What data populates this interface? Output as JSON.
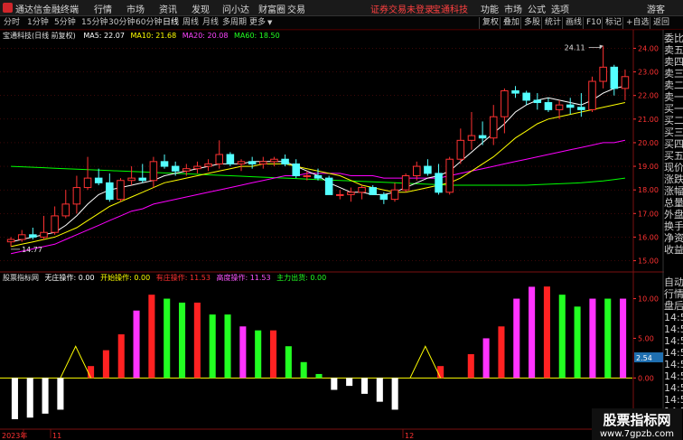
{
  "titlebar": {
    "app_title": "通达信金融终端",
    "menu": [
      "行情",
      "市场",
      "资讯",
      "发现",
      "问小达",
      "财富圈",
      "交易"
    ],
    "notice": "证券交易未登录",
    "stock_name": "宝通科技",
    "right": [
      "功能",
      "市场",
      "公式",
      "选项"
    ],
    "guest": "游客"
  },
  "toolbar": {
    "periods": [
      "分时",
      "1分钟",
      "5分钟",
      "15分钟",
      "30分钟",
      "60分钟",
      "日线",
      "周线",
      "月线",
      "多周期",
      "更多"
    ],
    "active_period": "日线",
    "right_buttons": [
      "复权",
      "叠加",
      "多股",
      "统计",
      "画线",
      "F10",
      "标记",
      "+自选",
      "返回"
    ]
  },
  "colors": {
    "up": "#ff3232",
    "down": "#54ffff",
    "ma5": "#ffffff",
    "ma10": "#ffff00",
    "ma20": "#ff00ff",
    "ma60": "#00ff00",
    "magenta_bar": "#ff33ff",
    "green_bar": "#22ff22",
    "red_bar": "#ff2222",
    "white_bar": "#ffffff",
    "yellow_line": "#ffff00",
    "grid": "#7a1010"
  },
  "main_info": {
    "name": "宝通科技(日线 前复权)",
    "ma5_label": "MA5: 22.07",
    "ma10_label": "MA10: 21.68",
    "ma20_label": "MA20: 20.08",
    "ma60_label": "MA60: 18.50"
  },
  "indicator_info": {
    "name": "股票指标网",
    "items": [
      {
        "label": "无庄操作: 0.00",
        "color": "#ffffff"
      },
      {
        "label": "开始操作: 0.00",
        "color": "#ffff00"
      },
      {
        "label": "有庄操作: 11.53",
        "color": "#ff3030"
      },
      {
        "label": "高度操作: 11.53",
        "color": "#ff55ff"
      },
      {
        "label": "主力出货: 0.00",
        "color": "#22ff22"
      }
    ]
  },
  "annotations": {
    "high": "24.11",
    "low": "14.77",
    "current_indicator": "2.54"
  },
  "axis": {
    "price_ticks": [
      "24.00",
      "23.00",
      "22.00",
      "21.00",
      "20.00",
      "19.00",
      "18.00",
      "17.00",
      "16.00",
      "15.00"
    ],
    "indicator_ticks": [
      "10.00",
      "5.00",
      "0.00"
    ],
    "x_labels": [
      "2023年",
      "11",
      "12"
    ]
  },
  "right_panel": {
    "top_items": [
      "委比",
      "卖五",
      "卖四",
      "卖三",
      "卖二",
      "卖一",
      "买一",
      "买二",
      "买三",
      "买四",
      "买五",
      "现价",
      "涨跌",
      "涨幅",
      "总量",
      "外盘",
      "换手",
      "净资",
      "收益"
    ],
    "bottom_items": [
      "自动",
      "行情",
      "盘后",
      "14:5",
      "14:5",
      "14:5",
      "14:5",
      "14:5",
      "14:5",
      "14:5",
      "14:5",
      "14:5"
    ]
  },
  "watermark": {
    "text": "股票指标网",
    "url": "www.7gpzb.com"
  },
  "chart_data": [
    {
      "type": "candlestick",
      "title": "宝通科技(日线 前复权)",
      "ylim": [
        14.6,
        24.4
      ],
      "y_ticks": [
        15,
        16,
        17,
        18,
        19,
        20,
        21,
        22,
        23,
        24
      ],
      "candles_ohlc": [
        [
          15.8,
          16.0,
          15.6,
          15.9
        ],
        [
          15.9,
          16.3,
          15.8,
          16.1
        ],
        [
          16.1,
          16.4,
          15.9,
          16.0
        ],
        [
          16.0,
          16.9,
          15.9,
          16.2
        ],
        [
          16.2,
          17.3,
          16.1,
          16.9
        ],
        [
          16.9,
          18.0,
          16.8,
          17.4
        ],
        [
          17.4,
          18.6,
          17.0,
          18.1
        ],
        [
          18.1,
          19.4,
          18.0,
          18.5
        ],
        [
          18.5,
          18.9,
          18.2,
          18.3
        ],
        [
          18.3,
          18.7,
          17.5,
          17.6
        ],
        [
          17.6,
          18.5,
          17.5,
          18.4
        ],
        [
          18.4,
          19.0,
          18.2,
          18.5
        ],
        [
          18.5,
          19.1,
          18.3,
          18.4
        ],
        [
          18.4,
          19.4,
          18.1,
          19.2
        ],
        [
          19.2,
          19.5,
          18.9,
          19.0
        ],
        [
          19.0,
          19.2,
          18.6,
          18.8
        ],
        [
          18.8,
          19.1,
          18.6,
          18.9
        ],
        [
          18.9,
          19.2,
          18.7,
          19.0
        ],
        [
          19.0,
          19.3,
          18.8,
          19.1
        ],
        [
          19.1,
          20.1,
          18.9,
          19.5
        ],
        [
          19.5,
          19.6,
          19.0,
          19.1
        ],
        [
          19.1,
          19.3,
          18.8,
          19.2
        ],
        [
          19.2,
          19.4,
          18.9,
          19.1
        ],
        [
          19.1,
          19.4,
          18.9,
          19.2
        ],
        [
          19.2,
          19.4,
          19.0,
          19.3
        ],
        [
          19.3,
          19.5,
          19.0,
          19.1
        ],
        [
          19.1,
          19.3,
          18.5,
          18.6
        ],
        [
          18.6,
          18.8,
          18.4,
          18.6
        ],
        [
          18.6,
          18.9,
          18.4,
          18.5
        ],
        [
          18.5,
          18.6,
          17.8,
          17.8
        ],
        [
          17.8,
          18.0,
          17.6,
          17.8
        ],
        [
          17.8,
          18.1,
          17.5,
          17.9
        ],
        [
          17.9,
          18.2,
          17.6,
          18.1
        ],
        [
          18.1,
          18.2,
          17.8,
          17.8
        ],
        [
          17.8,
          17.9,
          17.4,
          17.6
        ],
        [
          17.6,
          18.3,
          17.5,
          18.0
        ],
        [
          18.0,
          18.7,
          17.9,
          18.6
        ],
        [
          18.6,
          19.2,
          18.4,
          19.0
        ],
        [
          19.0,
          19.3,
          18.6,
          18.7
        ],
        [
          18.7,
          19.1,
          17.8,
          17.9
        ],
        [
          17.9,
          19.4,
          17.8,
          19.3
        ],
        [
          19.3,
          20.6,
          19.1,
          20.1
        ],
        [
          20.1,
          21.3,
          19.7,
          20.3
        ],
        [
          20.3,
          20.9,
          19.9,
          20.2
        ],
        [
          20.2,
          21.6,
          19.9,
          21.1
        ],
        [
          21.1,
          22.3,
          20.4,
          22.2
        ],
        [
          22.2,
          22.4,
          21.9,
          22.1
        ],
        [
          22.1,
          22.2,
          21.6,
          21.8
        ],
        [
          21.8,
          22.1,
          21.4,
          21.7
        ],
        [
          21.7,
          21.9,
          21.3,
          21.4
        ],
        [
          21.4,
          21.8,
          21.0,
          21.6
        ],
        [
          21.6,
          21.9,
          21.2,
          21.5
        ],
        [
          21.5,
          22.1,
          21.1,
          21.4
        ],
        [
          21.4,
          22.8,
          21.3,
          22.6
        ],
        [
          22.6,
          24.11,
          22.3,
          23.2
        ],
        [
          23.2,
          23.3,
          22.0,
          22.3
        ],
        [
          22.3,
          23.1,
          21.8,
          22.8
        ]
      ],
      "ma5": [
        15.8,
        15.9,
        16.0,
        16.1,
        16.2,
        16.5,
        16.9,
        17.4,
        17.8,
        18.0,
        18.1,
        18.2,
        18.3,
        18.4,
        18.6,
        18.7,
        18.8,
        18.9,
        19.0,
        19.1,
        19.1,
        19.1,
        19.2,
        19.2,
        19.2,
        19.2,
        19.0,
        18.8,
        18.6,
        18.3,
        18.1,
        17.9,
        17.9,
        17.8,
        17.8,
        17.9,
        18.1,
        18.3,
        18.5,
        18.6,
        18.8,
        19.2,
        19.6,
        20.0,
        20.4,
        20.8,
        21.3,
        21.6,
        21.8,
        21.9,
        21.8,
        21.7,
        21.6,
        21.8,
        22.1,
        22.3,
        22.4
      ],
      "ma10": [
        15.6,
        15.7,
        15.8,
        15.9,
        16.0,
        16.2,
        16.4,
        16.7,
        17.0,
        17.3,
        17.5,
        17.7,
        17.9,
        18.1,
        18.3,
        18.4,
        18.5,
        18.6,
        18.7,
        18.8,
        18.9,
        19.0,
        19.0,
        19.1,
        19.1,
        19.1,
        19.0,
        18.9,
        18.8,
        18.7,
        18.6,
        18.4,
        18.2,
        18.1,
        18.0,
        17.9,
        17.9,
        18.0,
        18.1,
        18.2,
        18.3,
        18.5,
        18.8,
        19.1,
        19.4,
        19.8,
        20.2,
        20.5,
        20.8,
        21.0,
        21.1,
        21.2,
        21.3,
        21.4,
        21.5,
        21.6,
        21.7
      ],
      "ma20": [
        15.3,
        15.4,
        15.5,
        15.6,
        15.7,
        15.9,
        16.1,
        16.3,
        16.5,
        16.7,
        16.9,
        17.1,
        17.2,
        17.4,
        17.5,
        17.6,
        17.7,
        17.8,
        17.9,
        18.0,
        18.1,
        18.2,
        18.3,
        18.4,
        18.5,
        18.6,
        18.6,
        18.7,
        18.7,
        18.7,
        18.7,
        18.6,
        18.6,
        18.6,
        18.5,
        18.5,
        18.5,
        18.5,
        18.5,
        18.5,
        18.6,
        18.7,
        18.8,
        18.9,
        19.0,
        19.1,
        19.2,
        19.3,
        19.4,
        19.5,
        19.6,
        19.7,
        19.8,
        19.9,
        20.0,
        20.0,
        20.1
      ],
      "ma60": [
        19.0,
        18.98,
        18.96,
        18.94,
        18.92,
        18.9,
        18.88,
        18.86,
        18.84,
        18.82,
        18.8,
        18.78,
        18.76,
        18.74,
        18.72,
        18.7,
        18.68,
        18.66,
        18.64,
        18.62,
        18.6,
        18.58,
        18.56,
        18.54,
        18.52,
        18.5,
        18.48,
        18.46,
        18.44,
        18.42,
        18.4,
        18.38,
        18.36,
        18.34,
        18.32,
        18.3,
        18.28,
        18.26,
        18.24,
        18.22,
        18.2,
        18.2,
        18.2,
        18.2,
        18.2,
        18.2,
        18.2,
        18.2,
        18.22,
        18.24,
        18.26,
        18.28,
        18.3,
        18.34,
        18.38,
        18.44,
        18.5
      ]
    },
    {
      "type": "bar",
      "ylim": [
        -6,
        12
      ],
      "y_ticks": [
        0,
        5,
        10
      ],
      "bars": [
        {
          "v": -5.2,
          "c": "white_bar"
        },
        {
          "v": -5.0,
          "c": "white_bar"
        },
        {
          "v": -4.5,
          "c": "white_bar"
        },
        {
          "v": -4.0,
          "c": "white_bar"
        },
        {
          "v": 0,
          "c": "none"
        },
        {
          "v": 1.5,
          "c": "red_bar"
        },
        {
          "v": 3.5,
          "c": "red_bar"
        },
        {
          "v": 5.5,
          "c": "red_bar"
        },
        {
          "v": 8.5,
          "c": "magenta_bar"
        },
        {
          "v": 10.5,
          "c": "red_bar"
        },
        {
          "v": 10.0,
          "c": "green_bar"
        },
        {
          "v": 9.5,
          "c": "green_bar"
        },
        {
          "v": 9.5,
          "c": "red_bar"
        },
        {
          "v": 8.0,
          "c": "green_bar"
        },
        {
          "v": 8.0,
          "c": "green_bar"
        },
        {
          "v": 6.5,
          "c": "magenta_bar"
        },
        {
          "v": 6.0,
          "c": "green_bar"
        },
        {
          "v": 6.0,
          "c": "red_bar"
        },
        {
          "v": 4.0,
          "c": "green_bar"
        },
        {
          "v": 2.0,
          "c": "green_bar"
        },
        {
          "v": 0.5,
          "c": "green_bar"
        },
        {
          "v": -1.5,
          "c": "white_bar"
        },
        {
          "v": -1.0,
          "c": "white_bar"
        },
        {
          "v": -2.0,
          "c": "white_bar"
        },
        {
          "v": -3.0,
          "c": "white_bar"
        },
        {
          "v": -4.0,
          "c": "white_bar"
        },
        {
          "v": 0,
          "c": "none"
        },
        {
          "v": 0,
          "c": "none"
        },
        {
          "v": 1.5,
          "c": "red_bar"
        },
        {
          "v": 0,
          "c": "none"
        },
        {
          "v": 3.0,
          "c": "red_bar"
        },
        {
          "v": 5.0,
          "c": "magenta_bar"
        },
        {
          "v": 6.5,
          "c": "red_bar"
        },
        {
          "v": 10.0,
          "c": "magenta_bar"
        },
        {
          "v": 11.5,
          "c": "magenta_bar"
        },
        {
          "v": 11.53,
          "c": "red_bar"
        },
        {
          "v": 10.5,
          "c": "green_bar"
        },
        {
          "v": 9.0,
          "c": "green_bar"
        },
        {
          "v": 10.0,
          "c": "magenta_bar"
        },
        {
          "v": 10.0,
          "c": "green_bar"
        },
        {
          "v": 10.0,
          "c": "magenta_bar"
        }
      ],
      "yellow_peaks": [
        {
          "start": 3,
          "peak": 4,
          "end": 5,
          "peak_value": 4.0
        },
        {
          "start": 26,
          "peak": 27,
          "end": 28,
          "peak_value": 4.0
        }
      ]
    }
  ]
}
